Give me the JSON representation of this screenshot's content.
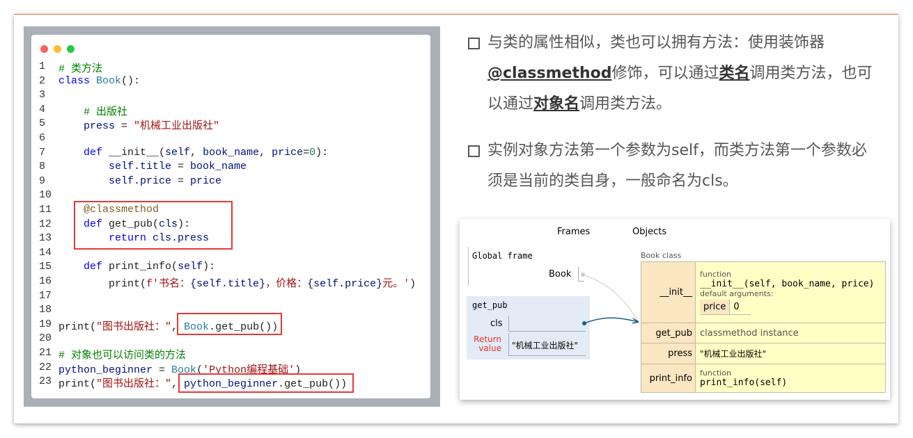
{
  "code": {
    "window_dots": [
      "#ff5f56",
      "#ffbd2e",
      "#27c93f"
    ],
    "lines": [
      [
        [
          "# 类方法",
          "cm"
        ]
      ],
      [
        [
          "class",
          "kw"
        ],
        [
          " ",
          ""
        ],
        [
          "Book",
          "cls"
        ],
        [
          "():",
          ""
        ]
      ],
      [],
      [
        [
          "    ",
          ""
        ],
        [
          "# 出版社",
          "cm"
        ]
      ],
      [
        [
          "    ",
          ""
        ],
        [
          "press",
          "id"
        ],
        [
          " = ",
          ""
        ],
        [
          "\"机械工业出版社\"",
          "st"
        ]
      ],
      [],
      [
        [
          "    ",
          ""
        ],
        [
          "def",
          "kw"
        ],
        [
          " __init__(",
          ""
        ],
        [
          "self",
          "id"
        ],
        [
          ", ",
          ""
        ],
        [
          "book_name",
          "id"
        ],
        [
          ", ",
          ""
        ],
        [
          "price",
          "id"
        ],
        [
          "=",
          ""
        ],
        [
          "0",
          "nm"
        ],
        [
          "):",
          ""
        ]
      ],
      [
        [
          "        ",
          ""
        ],
        [
          "self.title",
          "id"
        ],
        [
          " = ",
          ""
        ],
        [
          "book_name",
          "id"
        ]
      ],
      [
        [
          "        ",
          ""
        ],
        [
          "self.price",
          "id"
        ],
        [
          " = ",
          ""
        ],
        [
          "price",
          "id"
        ]
      ],
      [],
      [
        [
          "    ",
          ""
        ],
        [
          "@classmethod",
          "dec"
        ]
      ],
      [
        [
          "    ",
          ""
        ],
        [
          "def",
          "kw"
        ],
        [
          " get_pub(",
          ""
        ],
        [
          "cls",
          "id"
        ],
        [
          "):",
          ""
        ]
      ],
      [
        [
          "        ",
          ""
        ],
        [
          "return",
          "kw"
        ],
        [
          " ",
          ""
        ],
        [
          "cls.press",
          "id"
        ]
      ],
      [],
      [
        [
          "    ",
          ""
        ],
        [
          "def",
          "kw"
        ],
        [
          " print_info(",
          ""
        ],
        [
          "self",
          "id"
        ],
        [
          "):",
          ""
        ]
      ],
      [
        [
          "        print(",
          ""
        ],
        [
          "f'书名：",
          "st"
        ],
        [
          "{self.title}",
          "id"
        ],
        [
          "，价格：",
          "st"
        ],
        [
          "{self.price}",
          "id"
        ],
        [
          "元。'",
          "st"
        ],
        [
          ")",
          ""
        ]
      ],
      [],
      [],
      [
        [
          "print(",
          ""
        ],
        [
          "\"图书出版社：\"",
          "st"
        ],
        [
          ", ",
          ""
        ],
        [
          "Book",
          "cls"
        ],
        [
          ".get_pub())",
          ""
        ]
      ],
      [],
      [
        [
          "# 对象也可以访问类的方法",
          "cm"
        ]
      ],
      [
        [
          "python_beginner",
          "id"
        ],
        [
          " = ",
          ""
        ],
        [
          "Book",
          "cls"
        ],
        [
          "(",
          ""
        ],
        [
          "'Python编程基础'",
          "st"
        ],
        [
          ")",
          ""
        ]
      ],
      [
        [
          "print(",
          ""
        ],
        [
          "\"图书出版社：\"",
          "st"
        ],
        [
          ", ",
          ""
        ],
        [
          "python_beginner",
          "id"
        ],
        [
          ".get_pub())",
          ""
        ]
      ]
    ]
  },
  "bullets": [
    {
      "parts": [
        [
          "与类的属性相似，类也可以拥有方法：使用装饰器",
          ""
        ],
        [
          "@classmethod",
          "b"
        ],
        [
          "修饰，可以通过",
          ""
        ],
        [
          "类名",
          "b"
        ],
        [
          "调用类方法，也可以通过",
          ""
        ],
        [
          "对象名",
          "b"
        ],
        [
          "调用类方法。",
          ""
        ]
      ]
    },
    {
      "parts": [
        [
          "实例对象方法第一个参数为self，而类方法第一个参数必须是当前的类自身，一般命名为cls。",
          ""
        ]
      ]
    }
  ],
  "viz": {
    "frames_label": "Frames",
    "objects_label": "Objects",
    "global_frame": "Global frame",
    "global_var": "Book",
    "call_frame": "get_pub",
    "cls_label": "cls",
    "return_label": "Return value",
    "return_value": "\"机械工业出版社\"",
    "class_title": "Book class",
    "rows": [
      {
        "key": "__init__",
        "type": "function",
        "sig": "__init__(self, book_name, price)",
        "defaults_label": "default arguments:",
        "default_key": "price",
        "default_val": "0"
      },
      {
        "key": "get_pub",
        "type": "classmethod instance"
      },
      {
        "key": "press",
        "value": "\"机械工业出版社\""
      },
      {
        "key": "print_info",
        "type": "function",
        "sig": "print_info(self)"
      }
    ]
  }
}
